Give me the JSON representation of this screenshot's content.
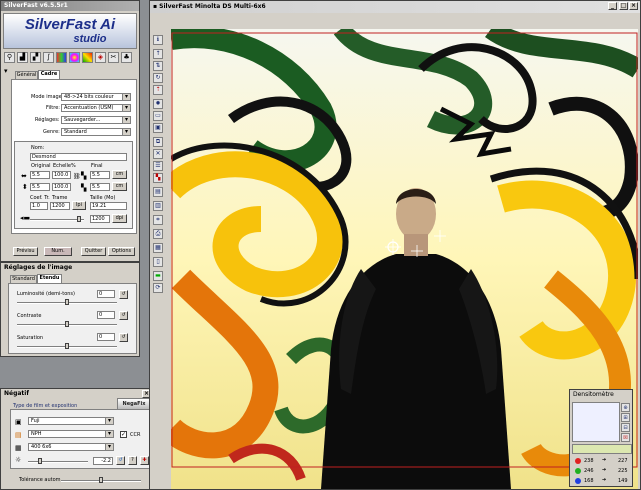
{
  "main": {
    "title": "SilverFast v6.5.5r1",
    "logo_line1": "SilverFast Ai",
    "logo_line2": "studio",
    "tabs": [
      "Général",
      "Cadre"
    ],
    "mode_label": "Mode image:",
    "mode_value": "48->24 bits couleur",
    "filtre_label": "Filtre:",
    "filtre_value": "Accentuation (USM)",
    "reglages_label": "Réglages:",
    "reglages_value": "Sauvegarder...",
    "genre_label": "Genre:",
    "genre_value": "Standard",
    "nom_label": "Nom:",
    "nom_value": "Desmond",
    "original_label": "Original",
    "echelle_label": "Echelle%",
    "final_label": "Final",
    "w_orig": "5.5",
    "w_scale": "100.0",
    "w_final": "5.5",
    "w_unit": "cm",
    "h_orig": "5.5",
    "h_scale": "100.0",
    "h_final": "5.5",
    "h_unit": "cm",
    "coef_label": "Coef. Tr.",
    "trame_label": "Trame",
    "taille_label": "Taille (Mo)",
    "coef_value": "1.0",
    "trame_value": "1200",
    "trame_unit": "lpi",
    "taille_value": "19.21",
    "res_value": "1200",
    "res_unit": "dpi",
    "btn_preview": "Prévisu",
    "btn_scan": "Num.",
    "btn_quit": "Quitter",
    "btn_options": "Options"
  },
  "reglages": {
    "title": "Réglages de l'image",
    "tabs": [
      "Standard",
      "Etendu"
    ],
    "lum_label": "Luminosité (demi-tons)",
    "lum_value": "0",
    "lum_level": 0.5,
    "contraste_label": "Contraste",
    "contraste_value": "0",
    "contraste_level": 0.5,
    "saturation_label": "Saturation",
    "saturation_value": "0",
    "saturation_level": 0.5
  },
  "negatif": {
    "title": "Négatif",
    "section_label": "Type de film et exposition",
    "logo": "NegaFix",
    "film_value": "Fuji",
    "type_value": "NPH",
    "format_value": "400 6x6",
    "ccr_label": "CCR",
    "exposure_value": "-2.2",
    "tolerance_label": "Tolérance autom.",
    "tolerance_level": 0.5
  },
  "preview": {
    "title": "SilverFast Minolta DS Multi-6x6"
  },
  "densito": {
    "title": "Densitomètre",
    "r1": "238",
    "r2": "227",
    "g1": "246",
    "g2": "225",
    "b1": "168",
    "b2": "149"
  },
  "colors": {
    "title_bar": "#5a7fb5",
    "window": "#d4d0c8",
    "selection": "#c02020"
  }
}
